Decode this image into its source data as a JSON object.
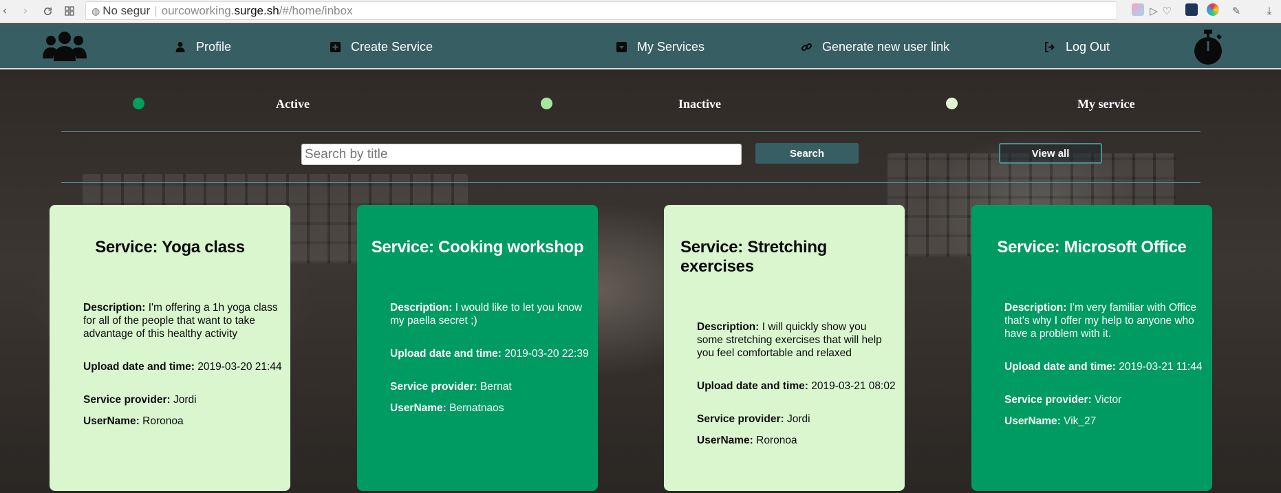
{
  "browser": {
    "security_label": "No segur",
    "url_host_prefix": "ourcoworking.",
    "url_host": "surge.sh",
    "url_path": "/#/home/inbox"
  },
  "nav": {
    "profile": "Profile",
    "create_service": "Create Service",
    "my_services": "My Services",
    "generate_link": "Generate new user link",
    "log_out": "Log Out"
  },
  "filters": {
    "active": "Active",
    "inactive": "Inactive",
    "my_service": "My service",
    "colors": {
      "active": "#00a05e",
      "inactive": "#a4e8a0",
      "my_service": "#dff6d0"
    }
  },
  "search": {
    "placeholder": "Search by title",
    "button": "Search",
    "view_all": "View all"
  },
  "labels": {
    "description": "Description:",
    "upload": "Upload date and time:",
    "provider": "Service provider:",
    "username": "UserName:"
  },
  "services": [
    {
      "title": "Service: Yoga class",
      "description": "I'm offering a 1h yoga class for all of the people that want to take advantage of this healthy activity",
      "upload": "2019-03-20 21:44",
      "provider": "Jordi",
      "username": "Roronoa",
      "status": "light"
    },
    {
      "title": "Service: Cooking workshop",
      "description": "I would like to let you know my paella secret ;)",
      "upload": "2019-03-20 22:39",
      "provider": "Bernat",
      "username": "Bernatnaos",
      "status": "dark"
    },
    {
      "title": "Service: Stretching exercises",
      "description": "I will quickly show you some stretching exercises that will help you feel comfortable and relaxed",
      "upload": "2019-03-21 08:02",
      "provider": "Jordi",
      "username": "Roronoa",
      "status": "light"
    },
    {
      "title": "Service: Microsoft Office",
      "description": "I'm very familiar with Office that's why I offer my help to anyone who have a problem with it.",
      "upload": "2019-03-21 11:44",
      "provider": "Victor",
      "username": "Vik_27",
      "status": "dark"
    }
  ],
  "colors": {
    "header": "#375e63",
    "card_light": "#d9f6cf",
    "card_dark": "#009b62"
  }
}
